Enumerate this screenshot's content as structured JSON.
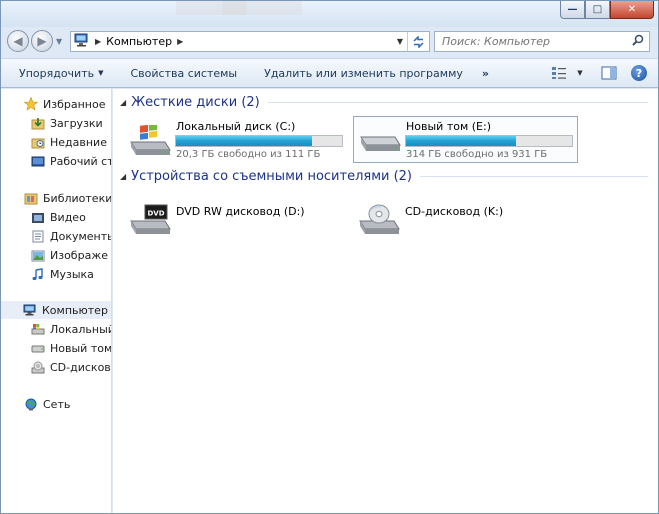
{
  "window": {
    "controls": {
      "minimize": "—",
      "maximize": "□",
      "close": "✕"
    }
  },
  "address": {
    "crumb": "Компьютер",
    "search_placeholder": "Поиск: Компьютер"
  },
  "toolbar": {
    "organize": "Упорядочить",
    "system_properties": "Свойства системы",
    "uninstall": "Удалить или изменить программу",
    "more": "»"
  },
  "nav": {
    "favorites": "Избранное",
    "downloads": "Загрузки",
    "recent": "Недавние ме",
    "desktop": "Рабочий сто",
    "libraries": "Библиотеки",
    "video": "Видео",
    "documents": "Документы",
    "images": "Изображе",
    "music": "Музыка",
    "computer": "Компьютер",
    "local_disk": "Локальный д",
    "new_volume": "Новый том (",
    "cd_drive": "CD-дисково",
    "network": "Сеть"
  },
  "groups": {
    "hard_disks": "Жесткие диски (2)",
    "removable": "Устройства со съемными носителями (2)"
  },
  "drives": [
    {
      "name": "Локальный диск (C:)",
      "free": "20,3 ГБ свободно из 111 ГБ",
      "used_fraction": 0.817
    },
    {
      "name": "Новый том (E:)",
      "free": "314 ГБ свободно из 931 ГБ",
      "used_fraction": 0.663
    }
  ],
  "removable": [
    {
      "name": "DVD RW дисковод (D:)",
      "label": "DVD"
    },
    {
      "name": "CD-дисковод (K:)"
    }
  ],
  "colors": {
    "accent": "#1e3287",
    "bar_fill": "#22a1d2"
  }
}
